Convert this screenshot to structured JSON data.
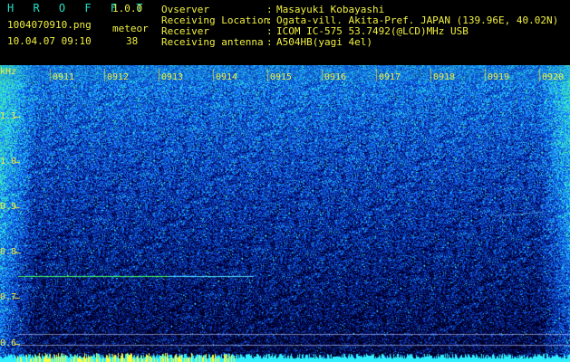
{
  "app": {
    "title": "H R O F F T",
    "version": "1.0.0"
  },
  "file": {
    "name": "1004070910.png",
    "datetime": "10.04.07 09:10"
  },
  "meteor": {
    "label": "meteor",
    "count": "38"
  },
  "info": [
    {
      "label": "Ovserver",
      "sep": ":",
      "value": "Masayuki Kobayashi"
    },
    {
      "label": "Receiving Location",
      "sep": ":",
      "value": "Ogata-vill. Akita-Pref. JAPAN (139.96E, 40.02N)"
    },
    {
      "label": "Receiver",
      "sep": ":",
      "value": "ICOM IC-575 53.7492(@LCD)MHz USB"
    },
    {
      "label": "Receiving antenna",
      "sep": ":",
      "value": "A504HB(yagi 4el)"
    }
  ],
  "spectrogram": {
    "y_unit": "kHz",
    "y_ticks": [
      "1.1",
      "1.0",
      "0.9",
      "0.8",
      "0.7",
      "0.6"
    ],
    "x_ticks": [
      "0911",
      "0912",
      "0913",
      "0914",
      "0915",
      "0916",
      "0917",
      "0918",
      "0919",
      "0920"
    ],
    "colors": {
      "background": "#000010",
      "low": "#0a1a8c",
      "mid": "#2a5cff",
      "high": "#30e8c0",
      "peak": "#ffff40"
    }
  }
}
